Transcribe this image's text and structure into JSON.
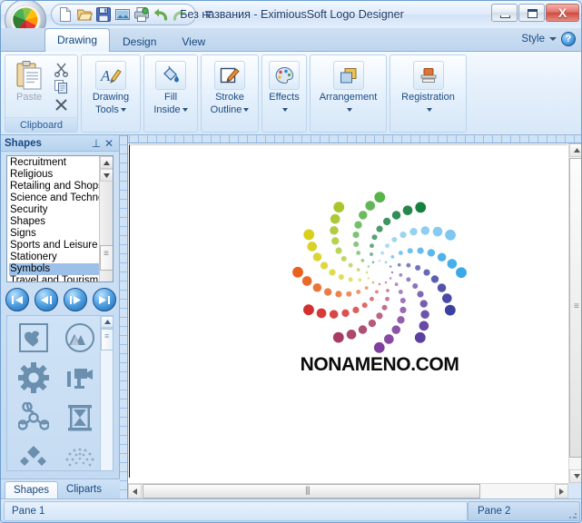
{
  "window": {
    "title": "Без названия - EximiousSoft Logo Designer",
    "minimize_label": "Minimize",
    "maximize_label": "Maximize",
    "close_label": "X"
  },
  "quick_access": {
    "items": [
      {
        "name": "new-document-icon",
        "label": "New"
      },
      {
        "name": "open-folder-icon",
        "label": "Open"
      },
      {
        "name": "save-disk-icon",
        "label": "Save"
      },
      {
        "name": "export-image-icon",
        "label": "Export Image"
      },
      {
        "name": "print-icon",
        "label": "Print"
      },
      {
        "name": "undo-icon",
        "label": "Undo"
      },
      {
        "name": "redo-icon",
        "label": "Redo"
      }
    ],
    "customize_label": "Customize Quick Access Toolbar"
  },
  "ribbon": {
    "tabs": [
      {
        "label": "Drawing",
        "active": true
      },
      {
        "label": "Design",
        "active": false
      },
      {
        "label": "View",
        "active": false
      }
    ],
    "style_label": "Style",
    "help_label": "?",
    "groups": [
      {
        "name": "clipboard",
        "footer": "Clipboard",
        "paste_label": "Paste",
        "cut_label": "Cut",
        "copy_label": "Copy",
        "delete_label": "Delete"
      },
      {
        "name": "drawing-tools",
        "label_line1": "Drawing",
        "label_line2": "Tools",
        "has_caret": true,
        "caret_inline": true
      },
      {
        "name": "fill-inside",
        "label_line1": "Fill",
        "label_line2": "Inside",
        "has_caret": true,
        "caret_inline": true
      },
      {
        "name": "stroke-outline",
        "label_line1": "Stroke",
        "label_line2": "Outline",
        "has_caret": true,
        "caret_inline": true
      },
      {
        "name": "effects",
        "label_line1": "Effects",
        "label_line2": "",
        "has_caret": true,
        "caret_inline": false
      },
      {
        "name": "arrangement",
        "label_line1": "Arrangement",
        "label_line2": "",
        "has_caret": true,
        "caret_inline": false
      },
      {
        "name": "registration",
        "label_line1": "Registration",
        "label_line2": "",
        "has_caret": true,
        "caret_inline": false
      }
    ]
  },
  "shapes_panel": {
    "title": "Shapes",
    "pin_label": "⊥",
    "close_label": "✕",
    "categories": [
      "Recruitment",
      "Religious",
      "Retailing and Shops",
      "Science and Techno",
      "Security",
      "Shapes",
      "Signs",
      "Sports and Leisure",
      "Stationery",
      "Symbols",
      "Travel and Tourism"
    ],
    "selected_category": "Symbols",
    "nav_buttons": [
      {
        "name": "first-page-button",
        "label": "|◀"
      },
      {
        "name": "previous-page-button",
        "label": "◀|"
      },
      {
        "name": "next-page-button",
        "label": "|▶"
      },
      {
        "name": "last-page-button",
        "label": "▶|"
      }
    ],
    "shape_items": [
      "heart-in-square-icon",
      "mountains-circle-icon",
      "gear-icon",
      "movie-camera-icon",
      "biohazard-icon",
      "hourglass-icon",
      "diamonds-icon",
      "radial-burst-icon"
    ],
    "bottom_tabs": [
      {
        "label": "Shapes",
        "active": true
      },
      {
        "label": "Cliparts",
        "active": false
      }
    ]
  },
  "canvas": {
    "brand_text": "NONAMENO.COM",
    "logo": {
      "name": "rainbow-spiral-dots-logo",
      "arms": 12,
      "dots_per_arm": 9,
      "colors": [
        "#7ec8ef",
        "#3aa9e8",
        "#2b6fc4",
        "#3b3fa0",
        "#5c3f9e",
        "#7e3f9e",
        "#9c3f91",
        "#a83a63",
        "#d32f2f",
        "#e8611f",
        "#f0a81c",
        "#d8cf1c",
        "#a8c62b",
        "#57b34a",
        "#1f9d55",
        "#17803f"
      ]
    }
  },
  "status_bar": {
    "pane1": "Pane 1",
    "pane2": "Pane 2"
  }
}
